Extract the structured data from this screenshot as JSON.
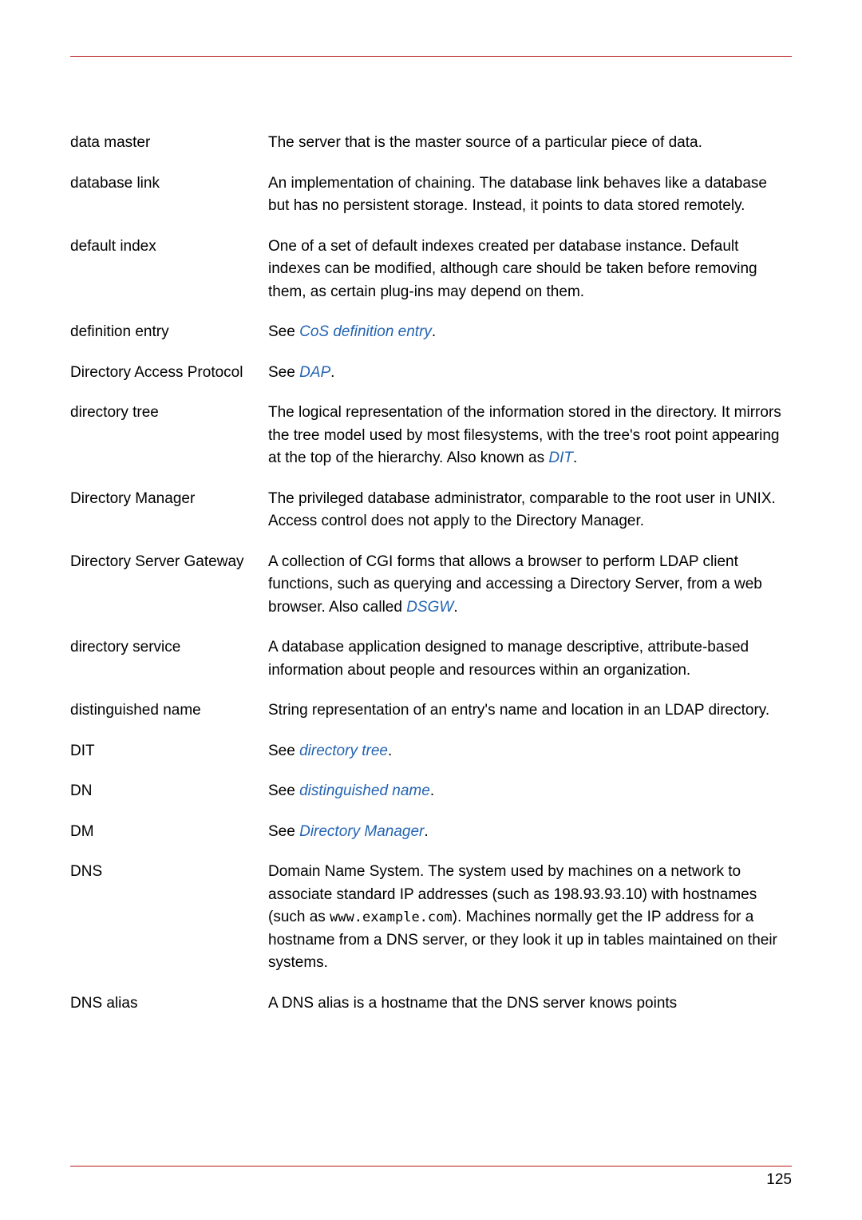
{
  "page_number": "125",
  "entries": [
    {
      "term": "data master",
      "def_parts": [
        {
          "text": "The server that is the master source of a particular piece of data."
        }
      ]
    },
    {
      "term": "database link",
      "def_parts": [
        {
          "text": "An implementation of chaining. The database link behaves like a database but has no persistent storage. Instead, it points to data stored remotely."
        }
      ]
    },
    {
      "term": "default index",
      "def_parts": [
        {
          "text": "One of a set of default indexes created per database instance. Default indexes can be modified, although care should be taken before removing them, as certain plug-ins may depend on them."
        }
      ]
    },
    {
      "term": "definition entry",
      "def_parts": [
        {
          "text": "See "
        },
        {
          "text": "CoS definition entry",
          "link": true
        },
        {
          "text": "."
        }
      ]
    },
    {
      "term": "Directory Access Protocol",
      "def_parts": [
        {
          "text": "See "
        },
        {
          "text": "DAP",
          "link": true
        },
        {
          "text": "."
        }
      ]
    },
    {
      "term": "directory tree",
      "def_parts": [
        {
          "text": "The logical representation of the information stored in the directory. It mirrors the tree model used by most filesystems, with the tree's root point appearing at the top of the hierarchy. Also known as "
        },
        {
          "text": "DIT",
          "link": true
        },
        {
          "text": "."
        }
      ]
    },
    {
      "term": "Directory Manager",
      "def_parts": [
        {
          "text": "The privileged database administrator, comparable to the root user in UNIX. Access control does not apply to the Directory Manager."
        }
      ]
    },
    {
      "term": "Directory Server Gateway",
      "def_parts": [
        {
          "text": "A collection of CGI forms that allows a browser to perform LDAP client functions, such as querying and accessing a Directory Server, from a web browser. Also called "
        },
        {
          "text": "DSGW",
          "link": true
        },
        {
          "text": "."
        }
      ]
    },
    {
      "term": "directory service",
      "def_parts": [
        {
          "text": "A database application designed to manage descriptive, attribute-based information about people and resources within an organization."
        }
      ]
    },
    {
      "term": "distinguished name",
      "def_parts": [
        {
          "text": "String representation of an entry's name and location in an LDAP directory."
        }
      ]
    },
    {
      "term": "DIT",
      "def_parts": [
        {
          "text": "See "
        },
        {
          "text": "directory tree",
          "link": true
        },
        {
          "text": "."
        }
      ]
    },
    {
      "term": "DN",
      "def_parts": [
        {
          "text": "See "
        },
        {
          "text": "distinguished name",
          "link": true
        },
        {
          "text": "."
        }
      ]
    },
    {
      "term": "DM",
      "def_parts": [
        {
          "text": "See "
        },
        {
          "text": "Directory Manager",
          "link": true
        },
        {
          "text": "."
        }
      ]
    },
    {
      "term": "DNS",
      "def_parts": [
        {
          "text": "Domain Name System. The system used by machines on a network to associate standard IP addresses (such as 198.93.93.10) with hostnames (such as "
        },
        {
          "text": "www.example.com",
          "mono": true
        },
        {
          "text": "). Machines normally get the IP address for a hostname from a DNS server, or they look it up in tables maintained on their systems."
        }
      ]
    },
    {
      "term": "DNS alias",
      "def_parts": [
        {
          "text": "A DNS alias is a hostname that the DNS server knows points"
        }
      ]
    }
  ]
}
